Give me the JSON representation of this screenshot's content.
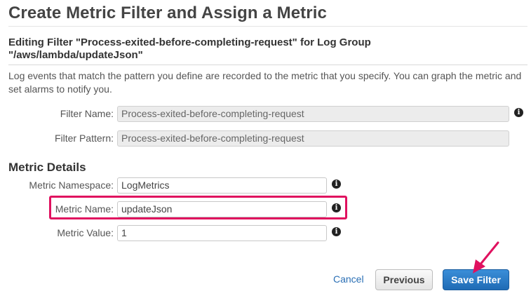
{
  "page": {
    "title": "Create Metric Filter and Assign a Metric",
    "subtitle": "Editing Filter \"Process-exited-before-completing-request\" for Log Group \"/aws/lambda/updateJson\"",
    "description": "Log events that match the pattern you define are recorded to the metric that you specify. You can graph the metric and set alarms to notify you."
  },
  "filter": {
    "name_label": "Filter Name:",
    "name_value": "Process-exited-before-completing-request",
    "pattern_label": "Filter Pattern:",
    "pattern_value": "Process-exited-before-completing-request"
  },
  "metric_details": {
    "heading": "Metric Details",
    "namespace_label": "Metric Namespace:",
    "namespace_value": "LogMetrics",
    "name_label": "Metric Name:",
    "name_value": "updateJson",
    "value_label": "Metric Value:",
    "value_value": "1"
  },
  "actions": {
    "cancel_label": "Cancel",
    "previous_label": "Previous",
    "save_label": "Save Filter"
  },
  "icons": {
    "info": "info-icon",
    "annotation_arrow": "arrow-icon"
  },
  "colors": {
    "highlight": "#e0115f",
    "primary_button": "#1f6bb5",
    "link": "#2a6fb5"
  }
}
